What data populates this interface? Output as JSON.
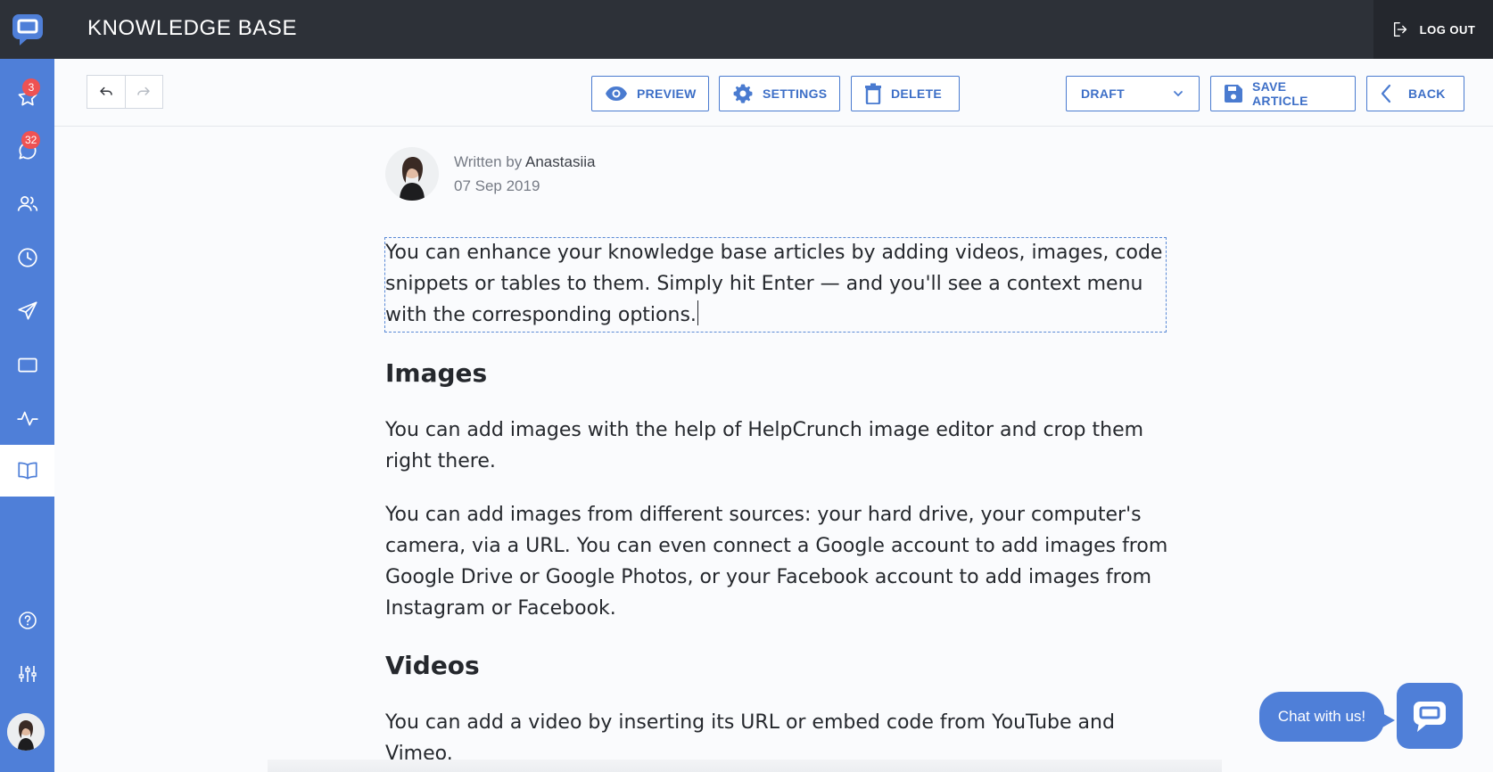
{
  "header": {
    "title": "KNOWLEDGE BASE",
    "logout_label": "LOG OUT"
  },
  "sidebar": {
    "badges": {
      "favorites": "3",
      "chats": "32"
    }
  },
  "toolbar": {
    "preview_label": "PREVIEW",
    "settings_label": "SETTINGS",
    "delete_label": "DELETE",
    "status_value": "DRAFT",
    "save_label": "SAVE ARTICLE",
    "back_label": "BACK"
  },
  "article": {
    "written_by": "Written by",
    "author": "Anastasiia",
    "date": "07 Sep 2019",
    "intro": "You can enhance your knowledge base articles by adding videos, images, code snippets or tables to them. Simply hit Enter — and you'll see a context menu with the corresponding options.",
    "h_images": "Images",
    "p_images_1": "You can add images with the help of HelpCrunch image editor and crop them right there.",
    "p_images_2": "You can add images from different sources: your hard drive, your computer's camera, via a URL. You can even connect a Google account to add images from Google Drive or Google Photos, or your Facebook account to add images from Instagram or Facebook.",
    "h_videos": "Videos",
    "p_videos_1": "You can add a video by inserting its URL or embed code from YouTube and Vimeo."
  },
  "chat_widget": {
    "label": "Chat with us!"
  },
  "colors": {
    "accent": "#4f7fd8",
    "dark": "#2d3138",
    "badge": "#ee5253"
  }
}
